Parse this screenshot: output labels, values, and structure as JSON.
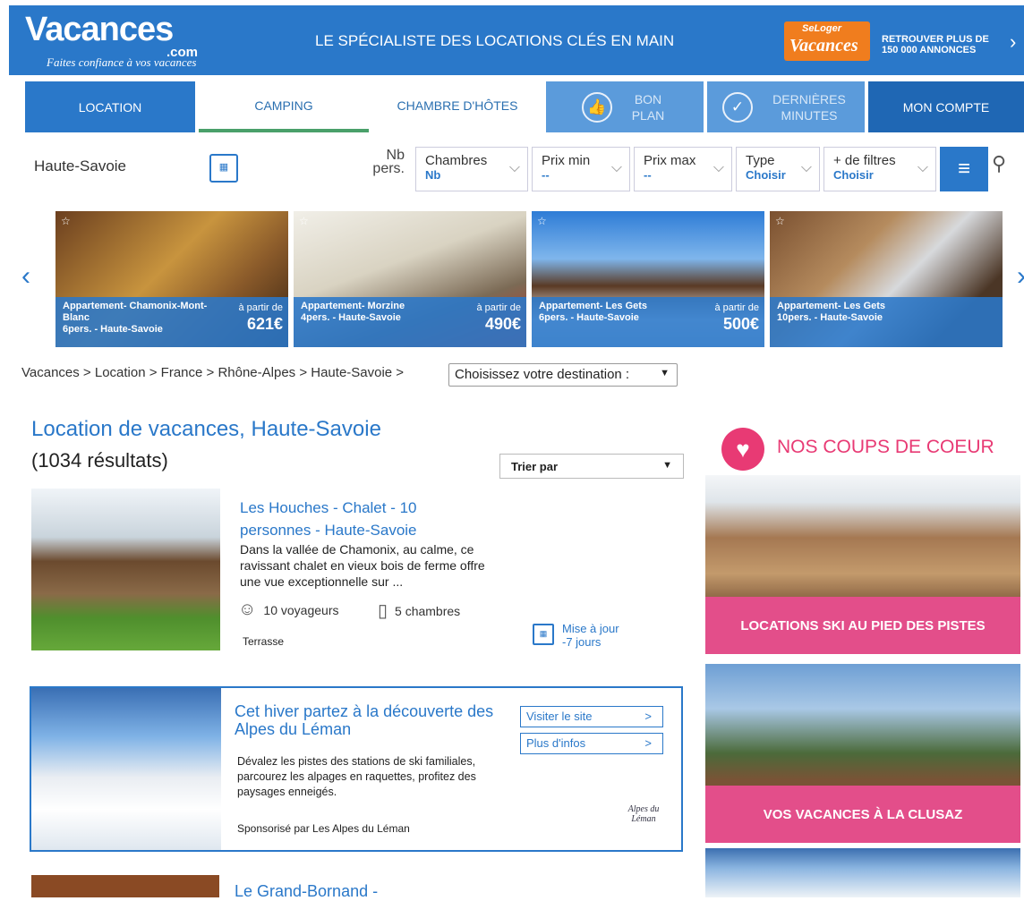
{
  "header": {
    "logo_text": "Vacances",
    "logo_suffix": ".com",
    "tagline": "Faites confiance à vos vacances",
    "slogan": "LE SPÉCIALISTE DES LOCATIONS CLÉS EN MAIN",
    "partner_small": "SeLoger",
    "partner_big": "Vacances",
    "partner_text": "RETROUVER PLUS DE 150 000 ANNONCES"
  },
  "tabs": {
    "location": "LOCATION",
    "camping": "CAMPING",
    "chambre": "CHAMBRE D'HÔTES",
    "bon_plan": "BON PLAN",
    "dernieres": "DERNIÈRES MINUTES",
    "compte": "MON COMPTE"
  },
  "search": {
    "destination": "Haute-Savoie",
    "nb_pers": "Nb pers.",
    "filters": [
      {
        "label": "Chambres",
        "value": "Nb"
      },
      {
        "label": "Prix min",
        "value": "--"
      },
      {
        "label": "Prix max",
        "value": "--"
      },
      {
        "label": "Type",
        "value": "Choisir"
      },
      {
        "label": "+ de filtres",
        "value": "Choisir"
      }
    ]
  },
  "carousel": [
    {
      "title": "Appartement- Chamonix-Mont-Blanc",
      "details": "6pers. - Haute-Savoie",
      "from": "à partir de",
      "price": "621€"
    },
    {
      "title": "Appartement- Morzine",
      "details": "4pers. - Haute-Savoie",
      "from": "à partir de",
      "price": "490€"
    },
    {
      "title": "Appartement- Les Gets",
      "details": "6pers. - Haute-Savoie",
      "from": "à partir de",
      "price": "500€"
    },
    {
      "title": "Appartement- Les Gets",
      "details": "10pers. - Haute-Savoie",
      "from": "",
      "price": ""
    }
  ],
  "breadcrumb": {
    "path": "Vacances > Location > France > Rhône-Alpes > Haute-Savoie >",
    "select": "Choisissez votre destination :"
  },
  "main": {
    "title": "Location de vacances, Haute-Savoie",
    "results": "(1034 résultats)",
    "sort_label": "Trier par"
  },
  "listing": {
    "title": "Les Houches - Chalet - 10 personnes - Haute-Savoie",
    "desc": "Dans la vallée de Chamonix, au calme, ce ravissant chalet en vieux bois de ferme offre une vue exceptionnelle sur ...",
    "voyageurs": "10 voyageurs",
    "chambres": "5 chambres",
    "feature": "Terrasse",
    "update": "Mise à jour",
    "update_age": "-7 jours"
  },
  "sponsor": {
    "title": "Cet hiver partez à la découverte des Alpes du Léman",
    "desc": "Dévalez les pistes des stations de ski familiales, parcourez les alpages en raquettes, profitez des paysages enneigés.",
    "by": "Sponsorisé par Les Alpes du Léman",
    "btn_visit": "Visiter le site",
    "btn_info": "Plus d'infos",
    "logo_text": "Alpes du Léman"
  },
  "next_listing_title": "Le Grand-Bornand -",
  "sidebar": {
    "heading": "NOS COUPS DE COEUR",
    "promo1": "LOCATIONS SKI AU PIED DES PISTES",
    "promo2": "VOS VACANCES À LA CLUSAZ"
  }
}
